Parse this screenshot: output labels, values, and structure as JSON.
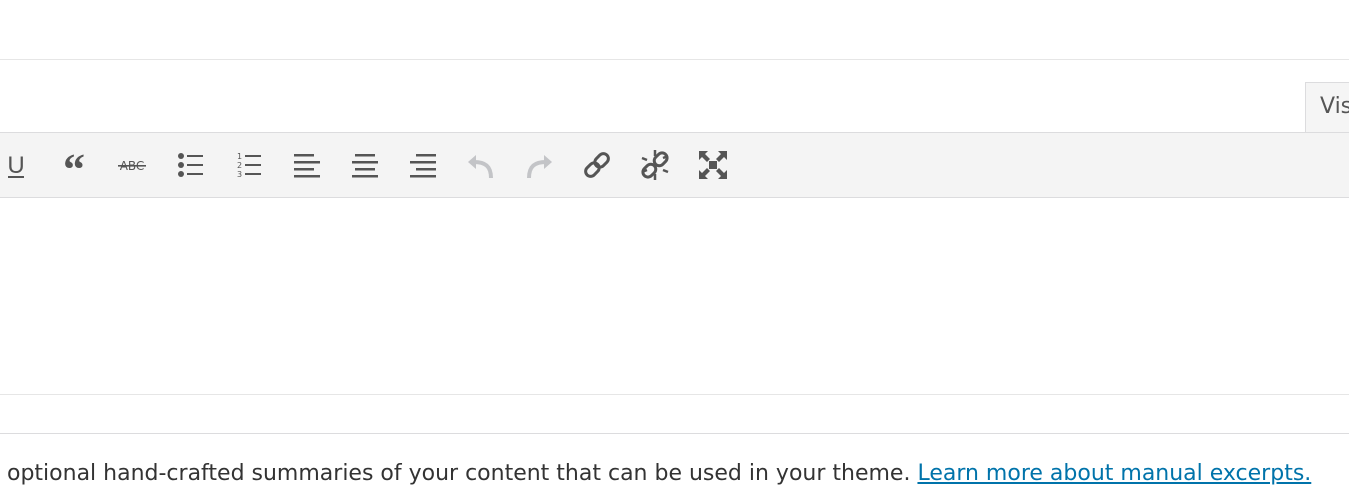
{
  "editor": {
    "tab_visual_label": "Vis",
    "toolbar": [
      {
        "name": "underline-icon",
        "glyph": "U"
      },
      {
        "name": "blockquote-icon",
        "glyph": "“"
      },
      {
        "name": "strikethrough-icon",
        "glyph": "ABC"
      },
      {
        "name": "bulleted-list-icon",
        "glyph": ""
      },
      {
        "name": "numbered-list-icon",
        "glyph": "1 2 3"
      },
      {
        "name": "align-left-icon",
        "glyph": ""
      },
      {
        "name": "align-center-icon",
        "glyph": ""
      },
      {
        "name": "align-right-icon",
        "glyph": ""
      },
      {
        "name": "undo-icon",
        "glyph": ""
      },
      {
        "name": "redo-icon",
        "glyph": ""
      },
      {
        "name": "insert-link-icon",
        "glyph": ""
      },
      {
        "name": "remove-link-icon",
        "glyph": ""
      },
      {
        "name": "fullscreen-icon",
        "glyph": ""
      }
    ],
    "colors": {
      "icon": "#555555",
      "icon_disabled": "#c3c4c7",
      "toolbar_bg": "#f4f4f4",
      "link": "#0073aa"
    }
  },
  "excerpt": {
    "description": "optional hand-crafted summaries of your content that can be used in your theme.",
    "learn_more_link": "Learn more about manual excerpts."
  }
}
